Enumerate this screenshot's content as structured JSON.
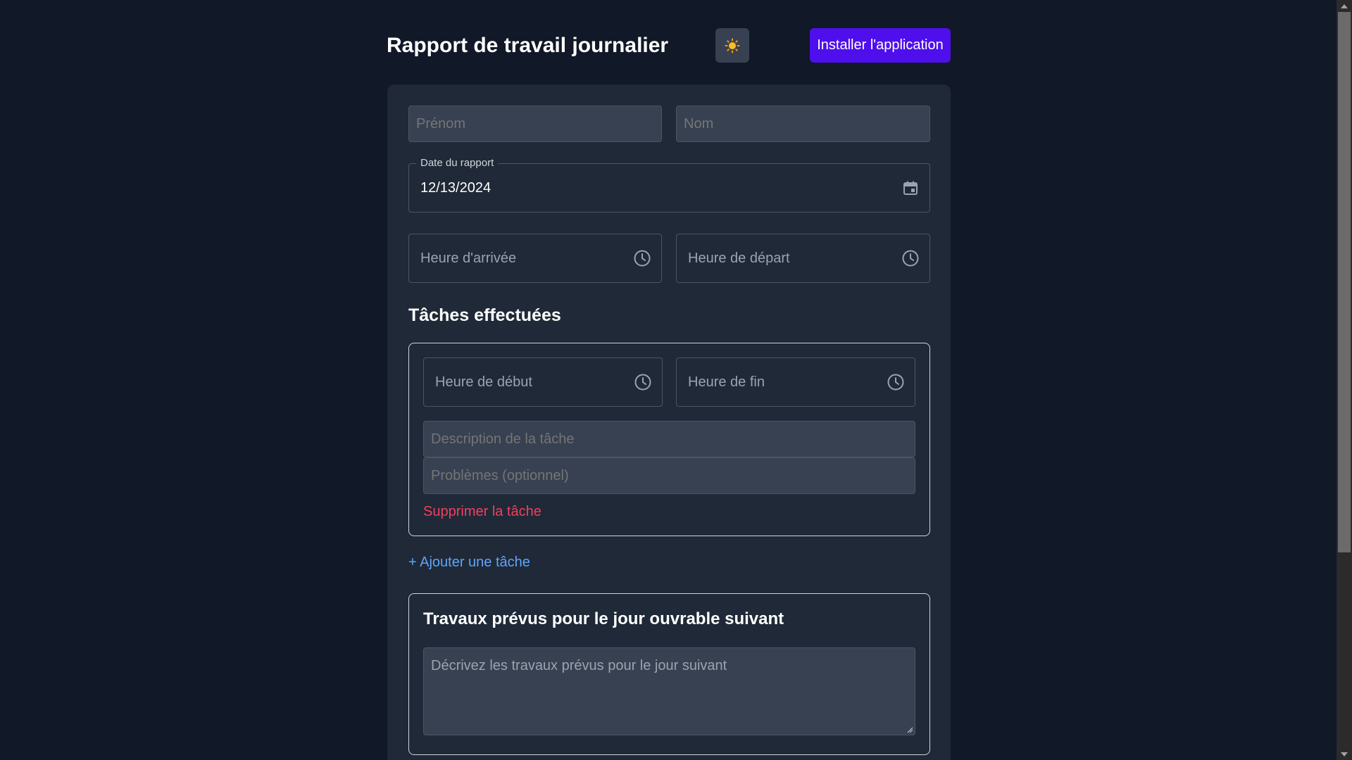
{
  "header": {
    "title": "Rapport de travail journalier",
    "theme_toggle_icon": "sun-icon",
    "install_label": "Installer l'application"
  },
  "form": {
    "first_name_placeholder": "Prénom",
    "last_name_placeholder": "Nom",
    "report_date_label": "Date du rapport",
    "report_date_value": "12/13/2024",
    "arrival_time_label": "Heure d'arrivée",
    "departure_time_label": "Heure de départ"
  },
  "tasks": {
    "section_title": "Tâches effectuées",
    "items": [
      {
        "start_time_label": "Heure de début",
        "end_time_label": "Heure de fin",
        "description_placeholder": "Description de la tâche",
        "problems_placeholder": "Problèmes (optionnel)",
        "delete_label": "Supprimer la tâche"
      }
    ],
    "add_label": "+ Ajouter une tâche"
  },
  "next_day": {
    "title": "Travaux prévus pour le jour ouvrable suivant",
    "placeholder": "Décrivez les travaux prévus pour le jour suivant"
  },
  "colors": {
    "background": "#111827",
    "card": "#1f2937",
    "input": "#374151",
    "accent": "#4f0fec",
    "danger": "#f43f5e",
    "link": "#60a5fa",
    "sun": "#fbbf24"
  }
}
